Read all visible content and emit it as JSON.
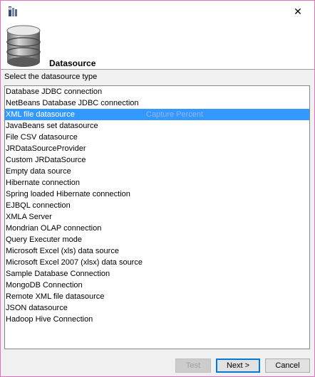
{
  "titlebar": {
    "app_icon": "jasper-report-icon",
    "close_symbol": "✕"
  },
  "header": {
    "icon": "database-icon",
    "title": "Datasource"
  },
  "prompt": "Select the datasource type",
  "list": {
    "selected_index": 2,
    "items": [
      "Database JDBC connection",
      "NetBeans Database JDBC connection",
      "XML file datasource",
      "JavaBeans set datasource",
      "File CSV datasource",
      "JRDataSourceProvider",
      "Custom JRDataSource",
      "Empty data source",
      "Hibernate connection",
      "Spring loaded Hibernate connection",
      "EJBQL connection",
      "XMLA Server",
      "Mondrian OLAP connection",
      "Query Executer mode",
      "Microsoft Excel (xls) data source",
      "Microsoft Excel 2007 (xlsx) data source",
      "Sample Database Connection",
      "MongoDB Connection",
      "Remote XML file datasource",
      "JSON datasource",
      "Hadoop Hive Connection"
    ],
    "overlay_text": "Capture Percent"
  },
  "buttons": {
    "test": "Test",
    "next": "Next >",
    "cancel": "Cancel"
  },
  "colors": {
    "selection": "#3399ff",
    "window_border": "#e070c0"
  }
}
